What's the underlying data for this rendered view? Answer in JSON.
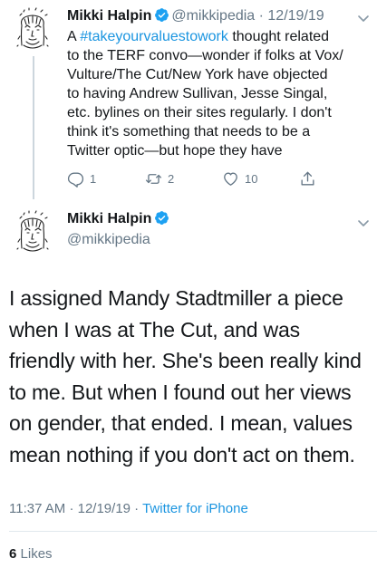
{
  "reply_to": {
    "name": "Mikki Halpin",
    "handle": "@mikkipedia",
    "separator": "·",
    "date": "12/19/19",
    "text_lines": [
      {
        "pre": "A ",
        "hashtag": "#takeyourvaluestowork",
        "post": " thought related"
      },
      "to the TERF convo—wonder if folks at Vox/",
      "Vulture/The Cut/New York have objected",
      "to having Andrew Sullivan, Jesse Singal,",
      "etc. bylines on their sites regularly. I don't",
      "think it's something that needs to be a",
      "Twitter optic—but hope they have"
    ],
    "actions": {
      "replies": "1",
      "retweets": "2",
      "likes": "10"
    },
    "icons": [
      "reply-icon",
      "retweet-icon",
      "like-icon",
      "share-icon",
      "verified-badge-icon",
      "chevron-down-icon"
    ]
  },
  "tweet": {
    "name": "Mikki Halpin",
    "handle": "@mikkipedia",
    "text_lines": [
      "I assigned Mandy Stadtmiller a piece",
      "when I was at The Cut, and was",
      "friendly with her. She's been really kind",
      "to me. But when I found out her views",
      "on gender, that ended. I mean, values",
      "mean nothing if you don't act on them."
    ],
    "time": "11:37 AM",
    "separator": "·",
    "date": "12/19/19",
    "source": "Twitter for iPhone",
    "likes_count": "6",
    "likes_label": "Likes"
  },
  "colors": {
    "text": "#14171a",
    "secondary": "#657786",
    "link": "#1b95e0",
    "verified": "#1da1f2",
    "divider": "#e1e8ed",
    "thread_line": "#ccd6dd"
  }
}
